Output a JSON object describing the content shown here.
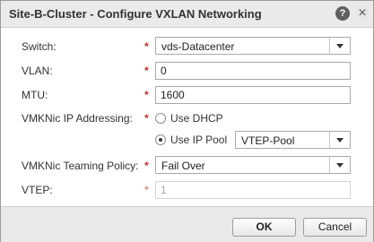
{
  "dialog": {
    "title": "Site-B-Cluster - Configure VXLAN Networking",
    "help_glyph": "?",
    "close_glyph": "×"
  },
  "form": {
    "switch": {
      "label": "Switch:",
      "value": "vds-Datacenter"
    },
    "vlan": {
      "label": "VLAN:",
      "value": "0"
    },
    "mtu": {
      "label": "MTU:",
      "value": "1600"
    },
    "vmknic_ip": {
      "label": "VMKNic IP Addressing:",
      "option_dhcp": "Use DHCP",
      "option_pool": "Use IP Pool",
      "selected": "Use IP Pool",
      "pool_value": "VTEP-Pool"
    },
    "teaming": {
      "label": "VMKNic Teaming Policy:",
      "value": "Fail Over"
    },
    "vtep": {
      "label": "VTEP:",
      "value": "1"
    },
    "required_marker": "*"
  },
  "buttons": {
    "ok": "OK",
    "cancel": "Cancel"
  },
  "colors": {
    "required": "#d9251d",
    "title_bar": "#eaeaea",
    "footer": "#e9e9e9"
  }
}
